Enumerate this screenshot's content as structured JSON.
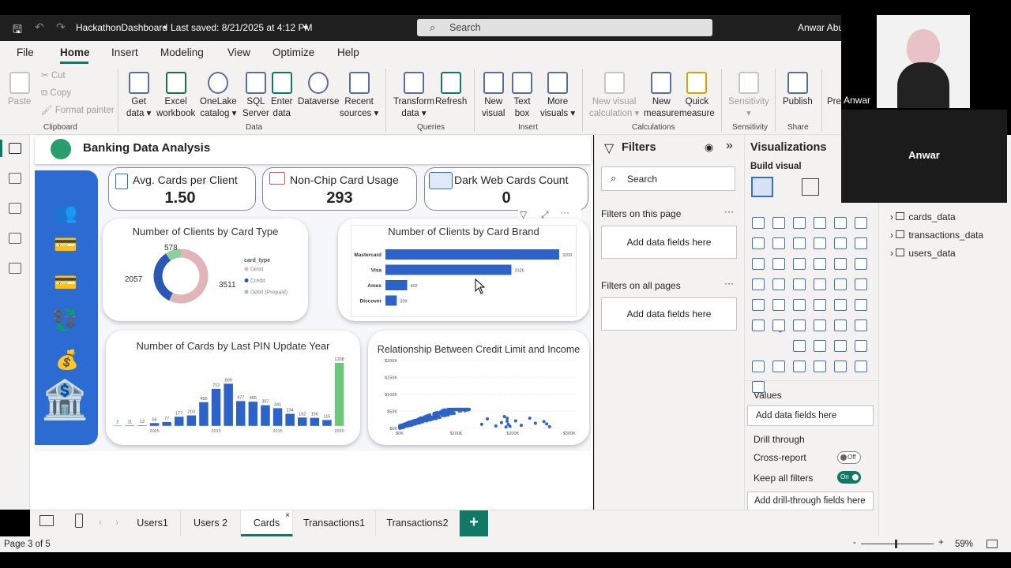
{
  "titlebar": {
    "file_name": "HackathonDashboard",
    "saved": "Last saved: 8/21/2025 at 4:12 PM",
    "search_placeholder": "Search",
    "user_name": "Anwar Abu"
  },
  "menu": [
    "File",
    "Home",
    "Insert",
    "Modeling",
    "View",
    "Optimize",
    "Help"
  ],
  "ribbon": {
    "clipboard": {
      "paste": "Paste",
      "cut": "Cut",
      "copy": "Copy",
      "format_painter": "Format painter",
      "label": "Clipboard"
    },
    "data": {
      "get_data": [
        "Get",
        "data ▾"
      ],
      "excel": [
        "Excel",
        "workbook"
      ],
      "onelake": [
        "OneLake",
        "catalog ▾"
      ],
      "sql": [
        "SQL",
        "Server"
      ],
      "enter": [
        "Enter",
        "data"
      ],
      "dataverse": [
        "Dataverse",
        ""
      ],
      "recent": [
        "Recent",
        "sources ▾"
      ],
      "label": "Data"
    },
    "queries": {
      "transform": [
        "Transform",
        "data ▾"
      ],
      "refresh": [
        "Refresh",
        ""
      ],
      "label": "Queries"
    },
    "insert": {
      "new_visual": [
        "New",
        "visual"
      ],
      "text_box": [
        "Text",
        "box"
      ],
      "more_visuals": [
        "More",
        "visuals ▾"
      ],
      "label": "Insert"
    },
    "calculations": {
      "new_visual_calc": [
        "New visual",
        "calculation ▾"
      ],
      "new_measure": [
        "New",
        "measure"
      ],
      "quick_measure": [
        "Quick",
        "measure"
      ],
      "label": "Calculations"
    },
    "sensitivity": {
      "sensitivity": [
        "Sensitivity",
        "▾"
      ],
      "label": "Sensitivity"
    },
    "share": {
      "publish": [
        "Publish",
        ""
      ],
      "label": "Share"
    },
    "pre": "Pre"
  },
  "report": {
    "title": "Banking Data Analysis",
    "kpis": [
      {
        "label": "Avg. Cards per Client",
        "value": "1.50"
      },
      {
        "label": "Non-Chip Card Usage",
        "value": "293"
      },
      {
        "label": "Dark Web Cards Count",
        "value": "0"
      }
    ]
  },
  "charts": {
    "donut_title": "Number of Clients by Card Type",
    "brand_title": "Number of Clients by Card Brand",
    "pin_title": "Number of Cards by Last PIN Update Year",
    "scatter_title": "Relationship Between Credit Limit and Income"
  },
  "chart_data": [
    {
      "type": "pie",
      "title": "Number of Clients by Card Type",
      "legend_title": "card_type",
      "legend_position": "right",
      "categories": [
        "Debit",
        "Credit",
        "Debit (Prepaid)"
      ],
      "values": [
        3511,
        2057,
        578
      ],
      "colors": [
        "#e0b5b9",
        "#2958b5",
        "#8ccf9a"
      ]
    },
    {
      "type": "bar",
      "orientation": "horizontal",
      "title": "Number of Clients by Card Brand",
      "categories": [
        "Mastercard",
        "Visa",
        "Amex",
        "Discover"
      ],
      "values": [
        3209,
        2326,
        402,
        209
      ],
      "color": "#2d63c8"
    },
    {
      "type": "bar",
      "title": "Number of Cards by Last PIN Update Year",
      "categories": [
        "2002",
        "2003",
        "2004",
        "2005",
        "2006",
        "2007",
        "2008",
        "2009",
        "2010",
        "2011",
        "2012",
        "2013",
        "2014",
        "2015",
        "2016",
        "2017",
        "2018",
        "2019",
        "2020"
      ],
      "values": [
        2,
        11,
        12,
        56,
        77,
        177,
        203,
        456,
        712,
        809,
        477,
        465,
        397,
        341,
        234,
        162,
        156,
        115,
        1208
      ],
      "x_tick_labels": [
        "2005",
        "2010",
        "2015",
        "2020"
      ],
      "highlight": {
        "category": "2020",
        "color": "#6cc77a"
      },
      "color": "#2d63c8"
    },
    {
      "type": "scatter",
      "title": "Relationship Between Credit Limit and Income",
      "x_ticks": [
        "$0K",
        "$100K",
        "$200K",
        "$300K"
      ],
      "y_ticks": [
        "$0K",
        "$50K",
        "$100K",
        "$150K",
        "$200K"
      ],
      "xlim": [
        0,
        310000
      ],
      "ylim": [
        0,
        200000
      ],
      "color": "#2d63c8"
    }
  ],
  "filters": {
    "title": "Filters",
    "search_placeholder": "Search",
    "this_page": "Filters on this page",
    "all_pages": "Filters on all pages",
    "add_fields": "Add data fields here"
  },
  "viz": {
    "title": "Visualizations",
    "build_visual": "Build visual",
    "values": "Values",
    "values_drop": "Add data fields here",
    "drill_through": "Drill through",
    "cross_report": "Cross-report",
    "cross_report_state": "Off",
    "keep_all": "Keep all filters",
    "keep_all_state": "On",
    "drill_drop": "Add drill-through fields here",
    "r_label": "R",
    "py_label": "Py",
    "more": "···"
  },
  "data_pane": {
    "tables": [
      "cards_data",
      "transactions_data",
      "users_data"
    ]
  },
  "tabs": {
    "pages": [
      "Users1",
      "Users 2",
      "Cards",
      "Transactions1",
      "Transactions2"
    ],
    "active": "Cards",
    "add": "+"
  },
  "status": {
    "page": "Page 3 of 5",
    "zoom": "59%"
  },
  "video": {
    "name1": "Anwar",
    "name2": "Anwar"
  }
}
